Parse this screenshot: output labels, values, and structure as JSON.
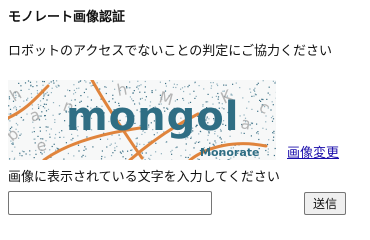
{
  "form": {
    "title": "モノレート画像認証",
    "description": "ロボットのアクセスでないことの判定にご協力ください",
    "captcha": {
      "word": "mongol",
      "watermark": "Monorate",
      "noise_letters": [
        "h",
        "a",
        "b",
        "e",
        "n",
        "h",
        "M",
        "K",
        "a",
        "c"
      ],
      "colors": {
        "word": "#2f6e84",
        "watermark": "#2f6e84",
        "noise_letters": "#aaaaaa",
        "curves": "#e0843c",
        "speckle": "#3a6e83",
        "background": "#f7f8f8"
      }
    },
    "change_image_label": "画像変更",
    "prompt": "画像に表示されている文字を入力してください",
    "answer": {
      "value": "",
      "placeholder": ""
    },
    "submit_label": "送信",
    "link_color": "#1a0dab"
  }
}
